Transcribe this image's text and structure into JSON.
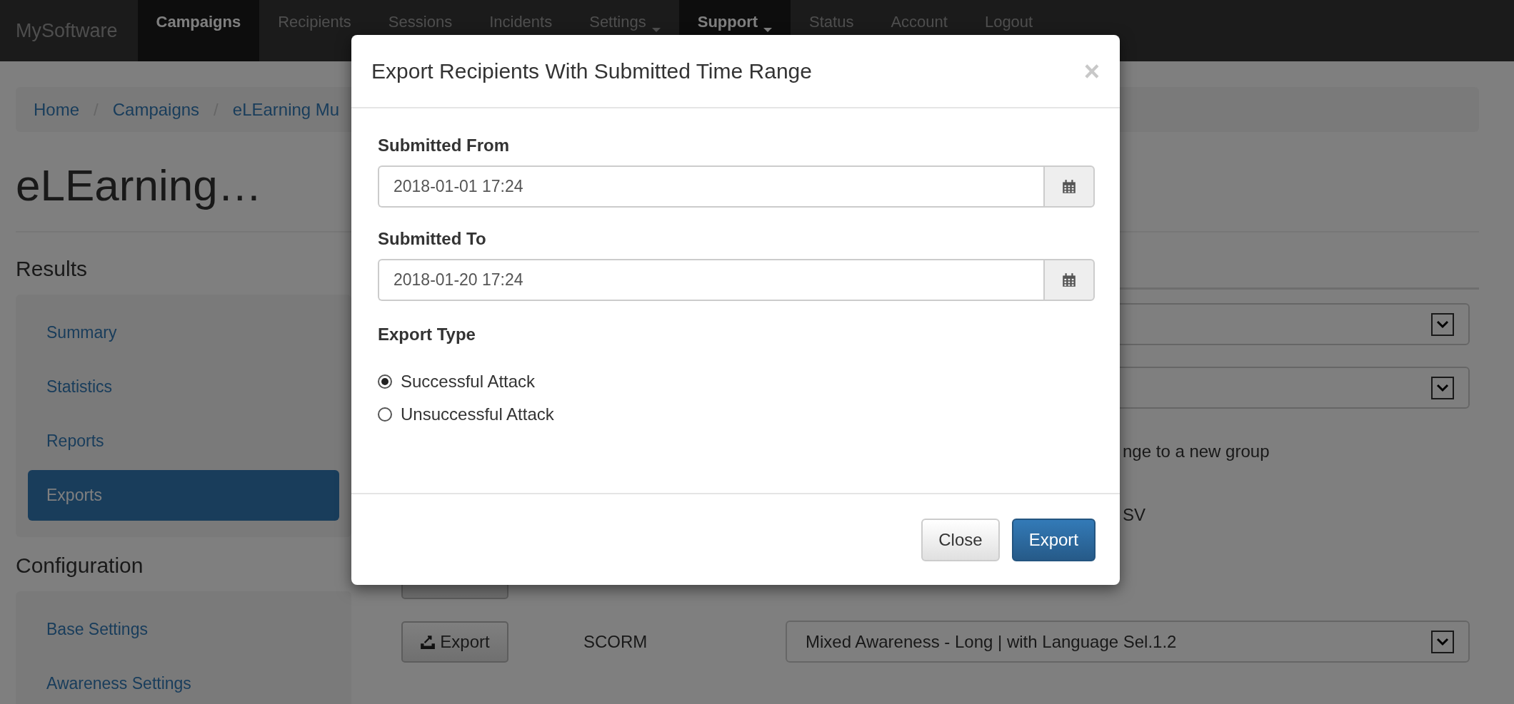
{
  "navbar": {
    "brand": "MySoftware",
    "items": [
      {
        "label": "Campaigns",
        "selected": true,
        "dropdown": false
      },
      {
        "label": "Recipients",
        "selected": false,
        "dropdown": false
      },
      {
        "label": "Sessions",
        "selected": false,
        "dropdown": false
      },
      {
        "label": "Incidents",
        "selected": false,
        "dropdown": false
      },
      {
        "label": "Settings",
        "selected": false,
        "dropdown": true
      },
      {
        "label": "Support",
        "selected": true,
        "dropdown": true
      },
      {
        "label": "Status",
        "selected": false,
        "dropdown": false
      },
      {
        "label": "Account",
        "selected": false,
        "dropdown": false
      },
      {
        "label": "Logout",
        "selected": false,
        "dropdown": false
      }
    ]
  },
  "breadcrumb": {
    "separator": "/",
    "items": [
      "Home",
      "Campaigns",
      "eLEarning Mu"
    ]
  },
  "page_title": "eLEarning…",
  "sidebar": [
    {
      "heading": "Results",
      "items": [
        {
          "label": "Summary",
          "selected": false
        },
        {
          "label": "Statistics",
          "selected": false
        },
        {
          "label": "Reports",
          "selected": false
        },
        {
          "label": "Exports",
          "selected": true
        }
      ]
    },
    {
      "heading": "Configuration",
      "items": [
        {
          "label": "Base Settings",
          "selected": false
        },
        {
          "label": "Awareness Settings",
          "selected": false
        }
      ]
    }
  ],
  "exports": [
    {
      "kind": "select"
    },
    {
      "kind": "select"
    },
    {
      "kind": "text",
      "description": "nge to a new group"
    },
    {
      "kind": "text",
      "description": "SV"
    },
    {
      "kind": "button"
    },
    {
      "kind": "full",
      "button": "Export",
      "name": "SCORM",
      "select_value": "Mixed Awareness - Long | with Language Sel.1.2"
    }
  ],
  "modal": {
    "title": "Export Recipients With Submitted Time Range",
    "close": "×",
    "fields": [
      {
        "label": "Submitted From",
        "value": "2018-01-01 17:24"
      },
      {
        "label": "Submitted To",
        "value": "2018-01-20 17:24"
      }
    ],
    "export_type": {
      "label": "Export Type",
      "options": [
        {
          "label": "Successful Attack",
          "selected": true
        },
        {
          "label": "Unsuccessful Attack",
          "selected": false
        }
      ]
    },
    "buttons": [
      {
        "label": "Close",
        "kind": "default"
      },
      {
        "label": "Export",
        "kind": "primary"
      }
    ]
  }
}
